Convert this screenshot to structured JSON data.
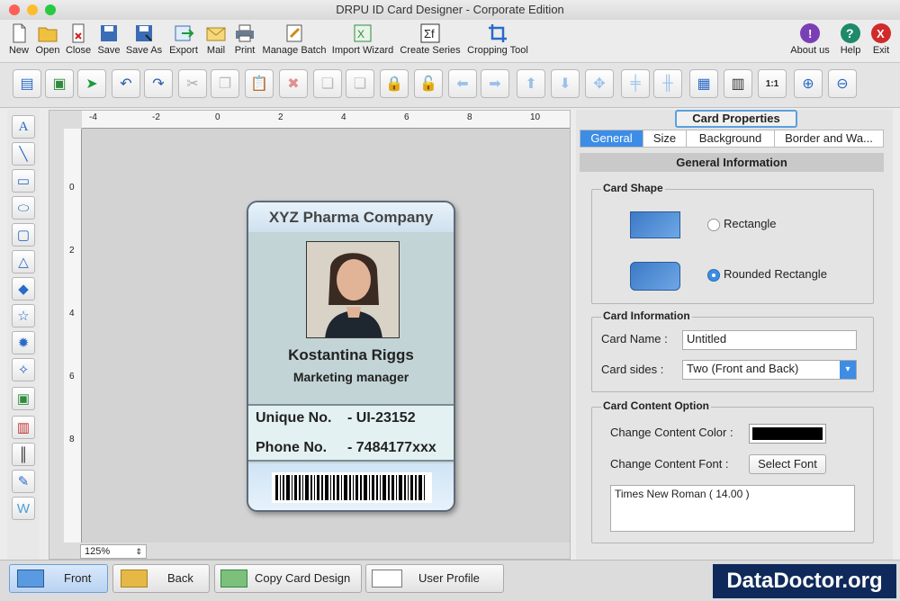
{
  "window": {
    "title": "DRPU ID Card Designer - Corporate Edition"
  },
  "toolbar": {
    "items": [
      "New",
      "Open",
      "Close",
      "Save",
      "Save As",
      "Export",
      "Mail",
      "Print",
      "Manage Batch",
      "Import Wizard",
      "Create Series",
      "Cropping Tool"
    ],
    "right": [
      "About us",
      "Help",
      "Exit"
    ]
  },
  "canvas": {
    "zoom": "125%",
    "ruler_h": [
      "-4",
      "-2",
      "0",
      "2",
      "4",
      "6",
      "8",
      "10"
    ],
    "ruler_v": [
      "0",
      "2",
      "4",
      "6",
      "8"
    ]
  },
  "card": {
    "company": "XYZ Pharma Company",
    "name": "Kostantina Riggs",
    "title": "Marketing manager",
    "unique_label": "Unique No.",
    "unique_value": "- UI-23152",
    "phone_label": "Phone No.",
    "phone_value": "- 7484177xxx"
  },
  "panel": {
    "title": "Card Properties",
    "tabs": [
      "General",
      "Size",
      "Background",
      "Border and Wa..."
    ],
    "section": "General Information",
    "shape": {
      "title": "Card Shape",
      "rect": "Rectangle",
      "rounded": "Rounded Rectangle",
      "selected": "Rounded Rectangle"
    },
    "info": {
      "title": "Card Information",
      "name_label": "Card Name :",
      "name_value": "Untitled",
      "sides_label": "Card sides :",
      "sides_value": "Two (Front and Back)"
    },
    "content": {
      "title": "Card Content Option",
      "color_label": "Change Content Color :",
      "color_value": "#000000",
      "font_label": "Change Content Font :",
      "font_button": "Select Font",
      "font_value": "Times New Roman ( 14.00 )"
    }
  },
  "bottom": {
    "front": "Front",
    "back": "Back",
    "copy": "Copy Card Design",
    "profile": "User Profile",
    "brand": "DataDoctor.org"
  }
}
